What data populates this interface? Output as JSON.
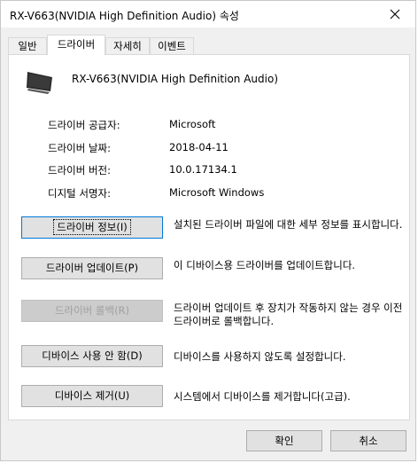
{
  "window": {
    "title": "RX-V663(NVIDIA High Definition Audio) 속성"
  },
  "tabs": [
    {
      "label": "일반"
    },
    {
      "label": "드라이버"
    },
    {
      "label": "자세히"
    },
    {
      "label": "이벤트"
    }
  ],
  "device": {
    "name": "RX-V663(NVIDIA High Definition Audio)",
    "icon": "monitor-icon"
  },
  "info": [
    {
      "label": "드라이버 공급자:",
      "value": "Microsoft"
    },
    {
      "label": "드라이버 날짜:",
      "value": "2018-04-11"
    },
    {
      "label": "드라이버 버전:",
      "value": "10.0.17134.1"
    },
    {
      "label": "디지털 서명자:",
      "value": "Microsoft Windows"
    }
  ],
  "actions": [
    {
      "button": "드라이버 정보(I)",
      "description": "설치된 드라이버 파일에 대한 세부 정보를 표시합니다."
    },
    {
      "button": "드라이버 업데이트(P)",
      "description": "이 디바이스용 드라이버를 업데이트합니다."
    },
    {
      "button": "드라이버 롤백(R)",
      "description": "드라이버 업데이트 후 장치가 작동하지 않는 경우 이전 드라이버로 롤백합니다."
    },
    {
      "button": "디바이스 사용 안 함(D)",
      "description": "디바이스를 사용하지 않도록 설정합니다."
    },
    {
      "button": "디바이스 제거(U)",
      "description": "시스템에서 디바이스를 제거합니다(고급)."
    }
  ],
  "footer": {
    "ok": "확인",
    "cancel": "취소"
  }
}
